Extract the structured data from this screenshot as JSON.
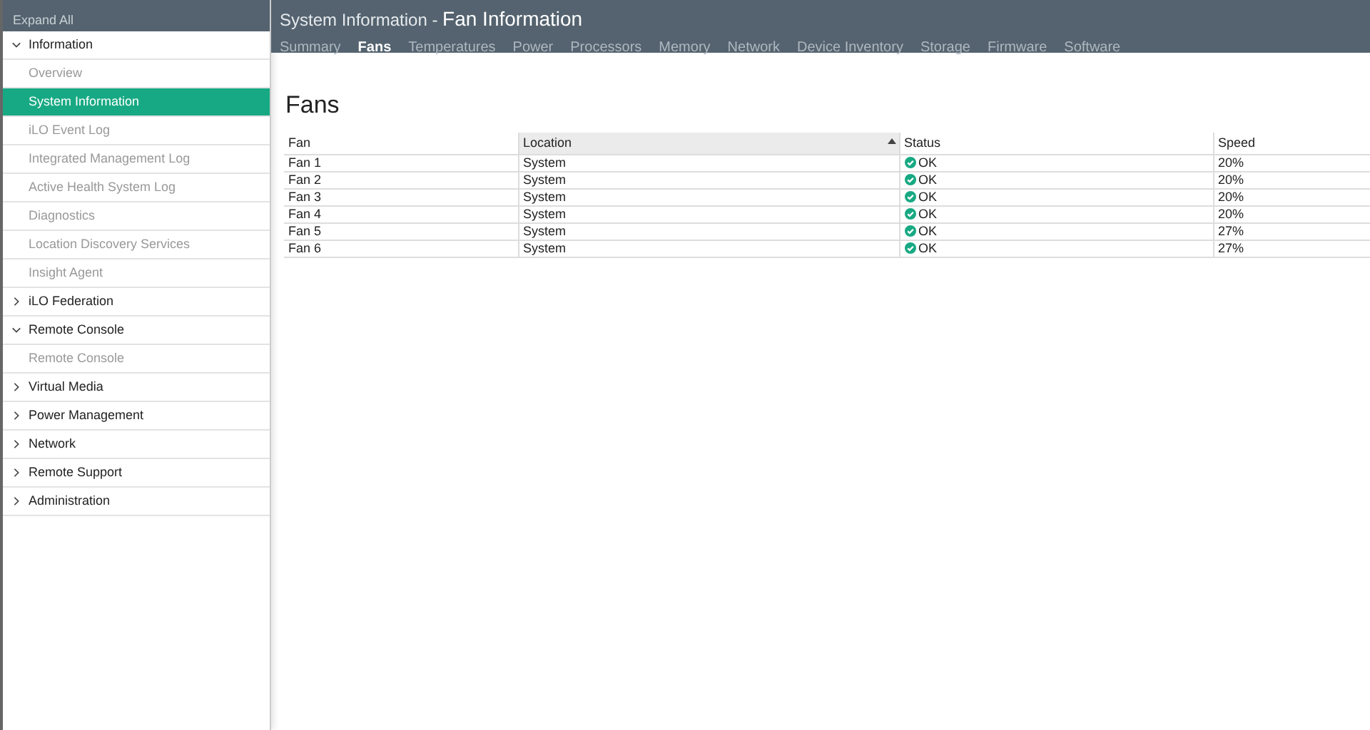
{
  "sidebar": {
    "expand_all": "Expand All",
    "groups": [
      {
        "label": "Information",
        "expanded": true,
        "children": [
          {
            "label": "Overview",
            "selected": false
          },
          {
            "label": "System Information",
            "selected": true
          },
          {
            "label": "iLO Event Log",
            "selected": false
          },
          {
            "label": "Integrated Management Log",
            "selected": false
          },
          {
            "label": "Active Health System Log",
            "selected": false
          },
          {
            "label": "Diagnostics",
            "selected": false
          },
          {
            "label": "Location Discovery Services",
            "selected": false
          },
          {
            "label": "Insight Agent",
            "selected": false
          }
        ]
      },
      {
        "label": "iLO Federation",
        "expanded": false
      },
      {
        "label": "Remote Console",
        "expanded": true,
        "children": [
          {
            "label": "Remote Console",
            "selected": false
          }
        ]
      },
      {
        "label": "Virtual Media",
        "expanded": false
      },
      {
        "label": "Power Management",
        "expanded": false
      },
      {
        "label": "Network",
        "expanded": false
      },
      {
        "label": "Remote Support",
        "expanded": false
      },
      {
        "label": "Administration",
        "expanded": false
      }
    ]
  },
  "header": {
    "section": "System Information - ",
    "title": "Fan Information"
  },
  "tabs": [
    {
      "label": "Summary",
      "selected": false
    },
    {
      "label": "Fans",
      "selected": true
    },
    {
      "label": "Temperatures",
      "selected": false
    },
    {
      "label": "Power",
      "selected": false
    },
    {
      "label": "Processors",
      "selected": false
    },
    {
      "label": "Memory",
      "selected": false
    },
    {
      "label": "Network",
      "selected": false
    },
    {
      "label": "Device Inventory",
      "selected": false
    },
    {
      "label": "Storage",
      "selected": false
    },
    {
      "label": "Firmware",
      "selected": false
    },
    {
      "label": "Software",
      "selected": false
    }
  ],
  "page_title": "Fans",
  "table": {
    "columns": [
      {
        "label": "Fan",
        "sorted": false
      },
      {
        "label": "Location",
        "sorted": true
      },
      {
        "label": "Status",
        "sorted": false
      },
      {
        "label": "Speed",
        "sorted": false
      }
    ],
    "rows": [
      {
        "fan": "Fan 1",
        "location": "System",
        "status": {
          "text": "OK",
          "kind": "ok"
        },
        "speed": "20%"
      },
      {
        "fan": "Fan 2",
        "location": "System",
        "status": {
          "text": "OK",
          "kind": "ok"
        },
        "speed": "20%"
      },
      {
        "fan": "Fan 3",
        "location": "System",
        "status": {
          "text": "OK",
          "kind": "ok"
        },
        "speed": "20%"
      },
      {
        "fan": "Fan 4",
        "location": "System",
        "status": {
          "text": "OK",
          "kind": "ok"
        },
        "speed": "20%"
      },
      {
        "fan": "Fan 5",
        "location": "System",
        "status": {
          "text": "OK",
          "kind": "ok"
        },
        "speed": "27%"
      },
      {
        "fan": "Fan 6",
        "location": "System",
        "status": {
          "text": "OK",
          "kind": "ok"
        },
        "speed": "27%"
      }
    ]
  }
}
